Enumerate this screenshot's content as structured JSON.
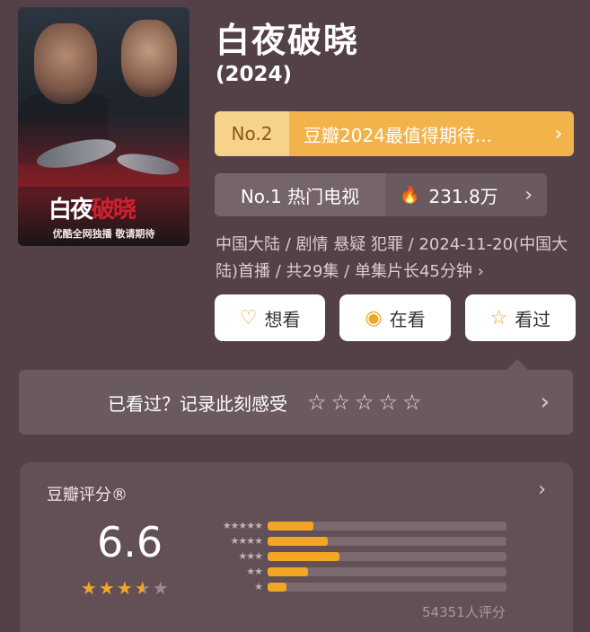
{
  "movie": {
    "title": "白夜破晓",
    "year": "(2024)",
    "poster": {
      "title_white": "白夜",
      "title_red": "破晓",
      "footer": "优酷全网独播 敬请期待"
    }
  },
  "ranking_primary": {
    "badge": "No.2",
    "text": "豆瓣2024最值得期待...",
    "chevron": "›"
  },
  "ranking_secondary": {
    "label": "No.1 热门电视",
    "icon": "fire-icon",
    "count": "231.8万",
    "chevron": "›"
  },
  "meta": {
    "text": "中国大陆 / 剧情 悬疑 犯罪 / 2024-11-20(中国大陆)首播 / 共29集 / 单集片长45分钟",
    "chevron": "›"
  },
  "actions": [
    {
      "label": "想看",
      "icon": "heart-plus-icon",
      "glyph": "♡"
    },
    {
      "label": "在看",
      "icon": "target-icon",
      "glyph": "◉"
    },
    {
      "label": "看过",
      "icon": "star-outline-icon",
      "glyph": "☆"
    }
  ],
  "record": {
    "label": "已看过？记录此刻感受",
    "stars": "☆☆☆☆☆",
    "chevron": "›"
  },
  "douban_rating": {
    "header": "豆瓣评分®",
    "score": "6.6",
    "stars_display": "★★★",
    "half_star": "★",
    "off_star": "★",
    "distribution": [
      {
        "label": "★★★★★",
        "fraction": 0.19
      },
      {
        "label": "★★★★",
        "fraction": 0.25
      },
      {
        "label": "★★★",
        "fraction": 0.3
      },
      {
        "label": "★★",
        "fraction": 0.17
      },
      {
        "label": "★",
        "fraction": 0.08
      }
    ],
    "count": "54351人评分"
  },
  "colors": {
    "background": "#544148",
    "accent": "#f2a623",
    "badge_bg": "#f6d28a",
    "card": "#6b5960"
  }
}
